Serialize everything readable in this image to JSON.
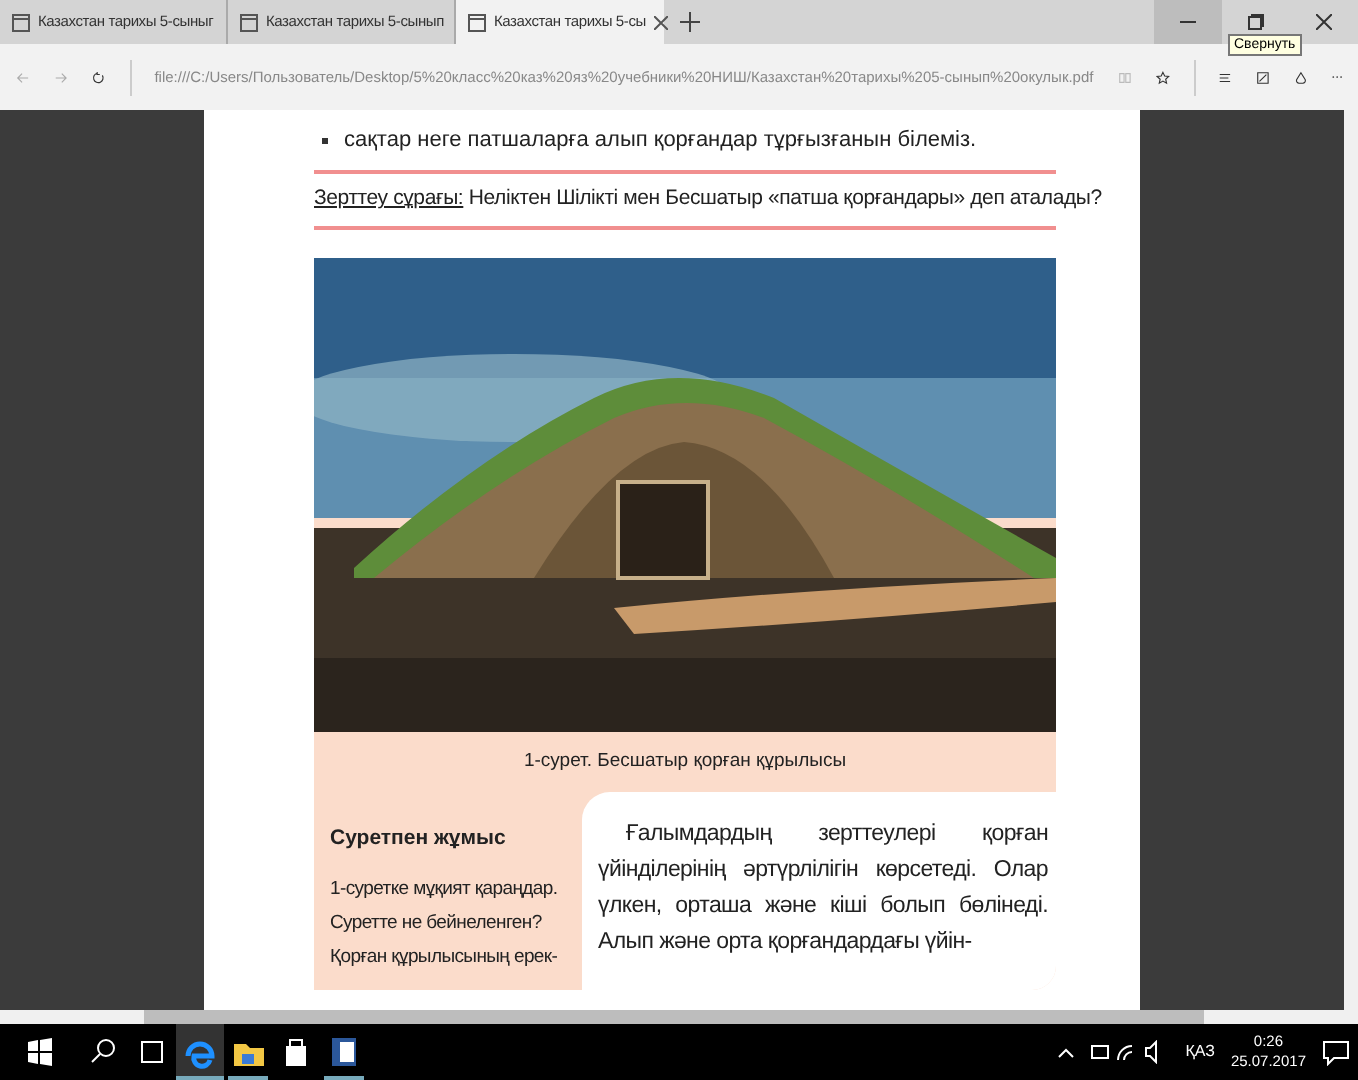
{
  "tabs": [
    {
      "label": "Казахстан тарихы 5-сыныг",
      "selected": false
    },
    {
      "label": "Казахстан тарихы 5-сынып",
      "selected": false
    },
    {
      "label": "Казахстан тарихы 5-сы",
      "selected": true
    }
  ],
  "tooltip": "Свернуть",
  "address": "file:///C:/Users/Пользователь/Desktop/5%20класс%20каз%20яз%20учебники%20НИШ/Казахстан%20тарихы%205-сынып%20окулык.pdf",
  "page": {
    "bullet": "сақтар неге патшаларға алып қорғандар тұрғызғанын білеміз.",
    "question_label": "Зерттеу сұрағы:",
    "question": "Неліктен Шілікті мен Бесшатыр «патша қорғандары» деп аталады?",
    "caption": "1-сурет. Бесшатыр қорған құрылысы",
    "side_title": "Суретпен жұмыс",
    "side_text": "1-суретке мұқият қараңдар. Суретте не бейнеленген? Қорған құрылысының ерек-",
    "body": "Ғалымдардың зерттеулері қорған үйінділерінің әртүрлілігін көрсетеді. Олар үлкен, орташа және кіші болып бөлінеді. Алып және орта қорғандардағы үйін-"
  },
  "taskbar": {
    "language": "ҚАЗ",
    "time": "0:26",
    "date": "25.07.2017"
  }
}
